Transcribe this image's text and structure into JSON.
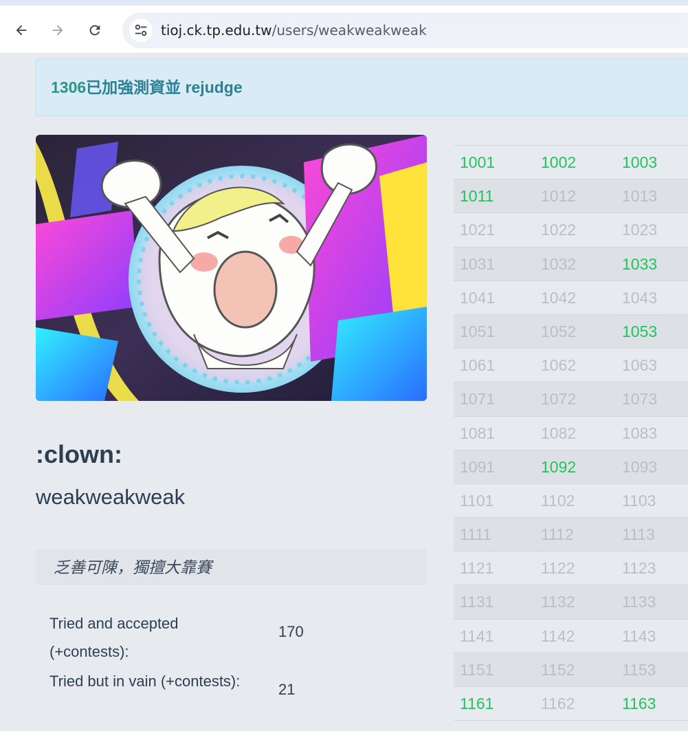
{
  "browser": {
    "url_host": "tioj.ck.tp.edu.tw",
    "url_path": "/users/weakweakweak"
  },
  "alert": {
    "number": "1306",
    "text": " 已加強測資並 rejudge"
  },
  "profile": {
    "nickname": ":clown:",
    "username": "weakweakweak",
    "motto": "乏善可陳，獨擅大靠賽",
    "stats": [
      {
        "label": "Tried and accepted (+contests):",
        "value": "170"
      },
      {
        "label": "Tried but in vain (+contests):",
        "value": "21"
      }
    ]
  },
  "colors": {
    "accepted": "#22c35e",
    "not_accepted": "#b9bfc6",
    "alert_text": "#2b8096"
  },
  "problems": {
    "rows": [
      [
        {
          "id": "1001",
          "ac": true
        },
        {
          "id": "1002",
          "ac": true
        },
        {
          "id": "1003",
          "ac": true
        }
      ],
      [
        {
          "id": "1011",
          "ac": true
        },
        {
          "id": "1012",
          "ac": false
        },
        {
          "id": "1013",
          "ac": false
        }
      ],
      [
        {
          "id": "1021",
          "ac": false
        },
        {
          "id": "1022",
          "ac": false
        },
        {
          "id": "1023",
          "ac": false
        }
      ],
      [
        {
          "id": "1031",
          "ac": false
        },
        {
          "id": "1032",
          "ac": false
        },
        {
          "id": "1033",
          "ac": true
        }
      ],
      [
        {
          "id": "1041",
          "ac": false
        },
        {
          "id": "1042",
          "ac": false
        },
        {
          "id": "1043",
          "ac": false
        }
      ],
      [
        {
          "id": "1051",
          "ac": false
        },
        {
          "id": "1052",
          "ac": false
        },
        {
          "id": "1053",
          "ac": true
        }
      ],
      [
        {
          "id": "1061",
          "ac": false
        },
        {
          "id": "1062",
          "ac": false
        },
        {
          "id": "1063",
          "ac": false
        }
      ],
      [
        {
          "id": "1071",
          "ac": false
        },
        {
          "id": "1072",
          "ac": false
        },
        {
          "id": "1073",
          "ac": false
        }
      ],
      [
        {
          "id": "1081",
          "ac": false
        },
        {
          "id": "1082",
          "ac": false
        },
        {
          "id": "1083",
          "ac": false
        }
      ],
      [
        {
          "id": "1091",
          "ac": false
        },
        {
          "id": "1092",
          "ac": true
        },
        {
          "id": "1093",
          "ac": false
        }
      ],
      [
        {
          "id": "1101",
          "ac": false
        },
        {
          "id": "1102",
          "ac": false
        },
        {
          "id": "1103",
          "ac": false
        }
      ],
      [
        {
          "id": "1111",
          "ac": false
        },
        {
          "id": "1112",
          "ac": false
        },
        {
          "id": "1113",
          "ac": false
        }
      ],
      [
        {
          "id": "1121",
          "ac": false
        },
        {
          "id": "1122",
          "ac": false
        },
        {
          "id": "1123",
          "ac": false
        }
      ],
      [
        {
          "id": "1131",
          "ac": false
        },
        {
          "id": "1132",
          "ac": false
        },
        {
          "id": "1133",
          "ac": false
        }
      ],
      [
        {
          "id": "1141",
          "ac": false
        },
        {
          "id": "1142",
          "ac": false
        },
        {
          "id": "1143",
          "ac": false
        }
      ],
      [
        {
          "id": "1151",
          "ac": false
        },
        {
          "id": "1152",
          "ac": false
        },
        {
          "id": "1153",
          "ac": false
        }
      ],
      [
        {
          "id": "1161",
          "ac": true
        },
        {
          "id": "1162",
          "ac": false
        },
        {
          "id": "1163",
          "ac": true
        }
      ]
    ]
  }
}
